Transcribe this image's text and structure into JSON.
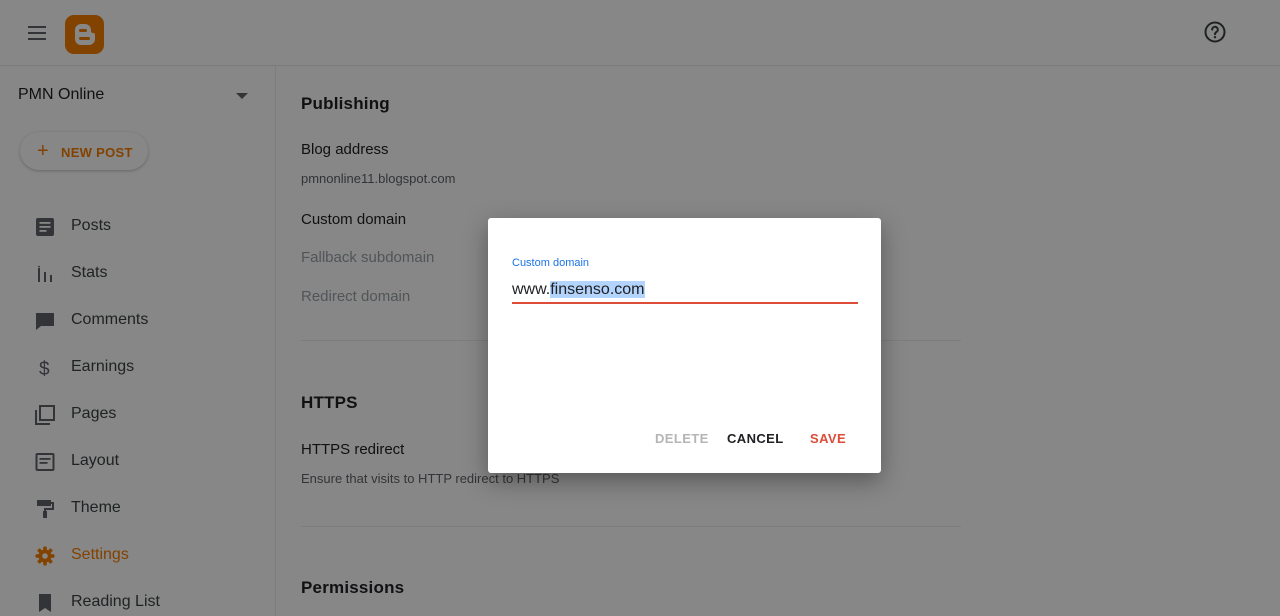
{
  "blog_name": "PMN Online",
  "new_post_label": "NEW POST",
  "nav_items": [
    {
      "label": "Posts",
      "icon": "posts-icon"
    },
    {
      "label": "Stats",
      "icon": "stats-icon"
    },
    {
      "label": "Comments",
      "icon": "comments-icon"
    },
    {
      "label": "Earnings",
      "icon": "dollar-icon"
    },
    {
      "label": "Pages",
      "icon": "pages-icon"
    },
    {
      "label": "Layout",
      "icon": "layout-icon"
    },
    {
      "label": "Theme",
      "icon": "paint-roller-icon"
    },
    {
      "label": "Settings",
      "icon": "gear-icon",
      "active": true
    },
    {
      "label": "Reading List",
      "icon": "bookmark-icon"
    }
  ],
  "main": {
    "publishing_heading": "Publishing",
    "blog_address_title": "Blog address",
    "blog_address_value": "pmnonline11.blogspot.com",
    "custom_domain_title": "Custom domain",
    "fallback_subdomain": "Fallback subdomain",
    "redirect_domain": "Redirect domain",
    "https_heading": "HTTPS",
    "https_redirect_title": "HTTPS redirect",
    "https_redirect_desc": "Ensure that visits to HTTP redirect to HTTPS",
    "permissions_heading": "Permissions"
  },
  "dialog": {
    "field_label": "Custom domain",
    "value_prefix": "www.",
    "value_selected": "finsenso.com",
    "delete_label": "DELETE",
    "cancel_label": "CANCEL",
    "save_label": "SAVE"
  },
  "colors": {
    "brand": "#f57d00",
    "accent_red": "#dd4b39",
    "label_blue": "#1a73e8",
    "selection": "#b3d4fc"
  }
}
